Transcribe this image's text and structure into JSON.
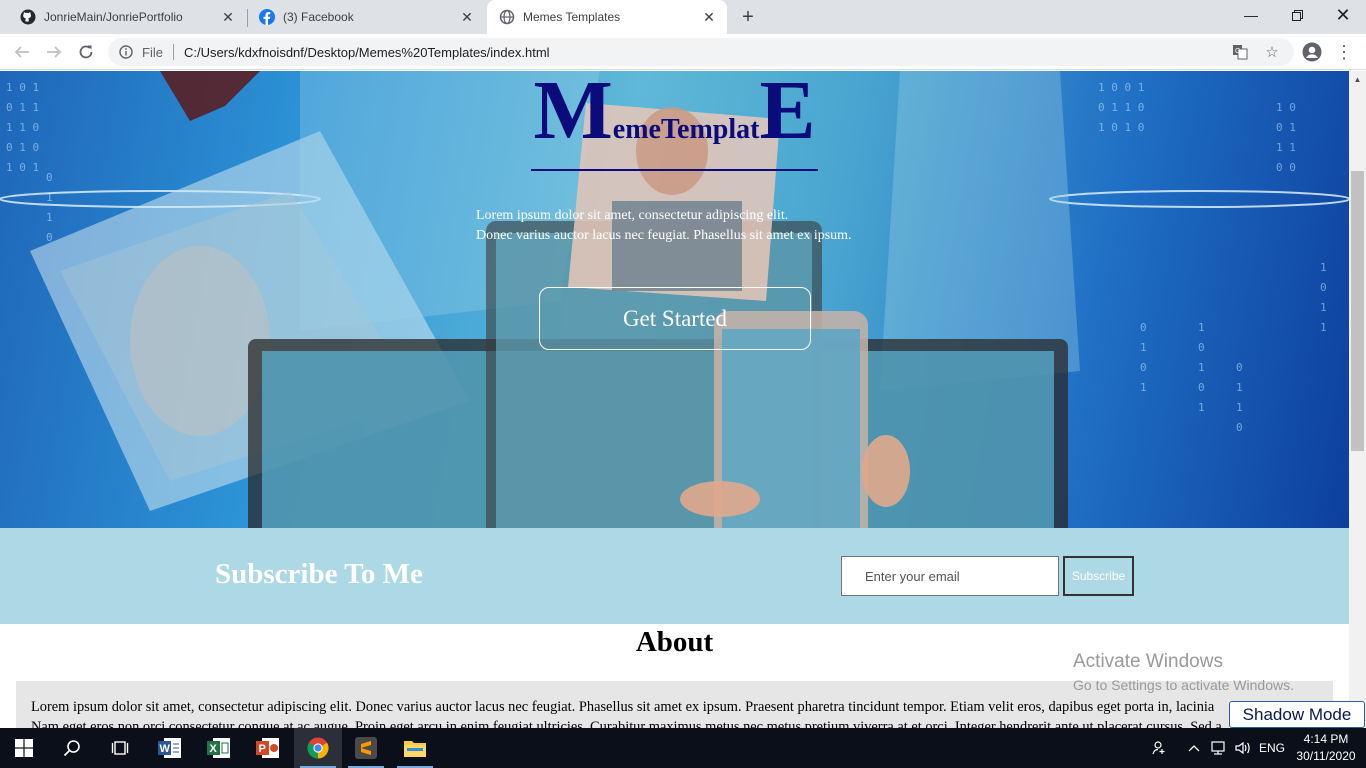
{
  "browser": {
    "tabs": [
      {
        "title": "JonrieMain/JonriePortfolio",
        "icon": "github-icon",
        "active": false
      },
      {
        "title": "(3) Facebook",
        "icon": "facebook-icon",
        "active": false
      },
      {
        "title": "Memes Templates",
        "icon": "globe-icon",
        "active": true
      }
    ],
    "url_scheme": "File",
    "url": "C:/Users/kdxfnoisdnf/Desktop/Memes%20Templates/index.html"
  },
  "hero": {
    "logo_first": "M",
    "logo_middle": "emeTemplat",
    "logo_last": "E",
    "text_line1": "Lorem ipsum dolor sit amet, consectetur adipiscing elit.",
    "text_line2": "Donec varius auctor lacus nec feugiat. Phasellus sit amet ex ipsum.",
    "cta_label": "Get Started"
  },
  "subscribe": {
    "title": "Subscribe To Me",
    "email_placeholder": "Enter your email",
    "button_label": "Subscribe"
  },
  "about": {
    "title": "About",
    "line1": "Lorem ipsum dolor sit amet, consectetur adipiscing elit. Donec varius auctor lacus nec feugiat. Phasellus sit amet ex ipsum. Praesent pharetra tincidunt tempor. Etiam velit eros, dapibus eget porta in, lacinia",
    "line2": "Nam eget eros non orci consectetur congue at ac augue. Proin eget arcu in enim feugiat ultricies. Curabitur maximus metus nec metus pretium viverra at et orci. Integer hendrerit ante ut placerat cursus. Sed a"
  },
  "watermark": {
    "line1": "Activate Windows",
    "line2": "Go to Settings to activate Windows."
  },
  "shadow_mode_label": "Shadow Mode",
  "taskbar": {
    "language": "ENG",
    "time": "4:14 PM",
    "date": "30/11/2020"
  },
  "colors": {
    "logo": "#0b0b7c",
    "subscribe_bg": "#add8e6",
    "about_bg": "#e6e6e6",
    "taskbar_bg": "#0b0f1a"
  }
}
